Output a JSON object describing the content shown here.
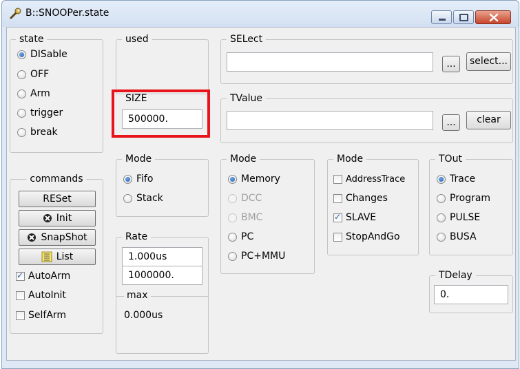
{
  "window": {
    "title": "B::SNOOPer.state",
    "icon": "wrench-icon",
    "controls": [
      "minimize",
      "maximize",
      "close"
    ]
  },
  "state": {
    "label": "state",
    "options": [
      "DISable",
      "OFF",
      "Arm",
      "trigger",
      "break"
    ],
    "selected": "DISable"
  },
  "commands": {
    "label": "commands",
    "buttons": {
      "reset": "RESet",
      "init": "Init",
      "snapshot": "SnapShot",
      "list": "List"
    },
    "checks": [
      {
        "label": "AutoArm",
        "checked": true
      },
      {
        "label": "AutoInit",
        "checked": false
      },
      {
        "label": "SelfArm",
        "checked": false
      }
    ]
  },
  "used": {
    "label": "used"
  },
  "size": {
    "label": "SIZE",
    "value": "500000."
  },
  "mode_buffer": {
    "label": "Mode",
    "options": [
      "Fifo",
      "Stack"
    ],
    "selected": "Fifo"
  },
  "rate": {
    "label": "Rate",
    "value1": "1.000us",
    "value2": "1000000.",
    "max_label": "max",
    "max_value": "0.000us"
  },
  "select": {
    "label": "SELect",
    "value": "",
    "browse_label": "...",
    "button_label": "select..."
  },
  "tvalue": {
    "label": "TValue",
    "value": "",
    "browse_label": "...",
    "button_label": "clear"
  },
  "mode_access": {
    "label": "Mode",
    "options": [
      {
        "label": "Memory",
        "enabled": true
      },
      {
        "label": "DCC",
        "enabled": false
      },
      {
        "label": "BMC",
        "enabled": false
      },
      {
        "label": "PC",
        "enabled": true
      },
      {
        "label": "PC+MMU",
        "enabled": true
      }
    ],
    "selected": "Memory"
  },
  "mode_flags": {
    "label": "Mode",
    "checks": [
      {
        "label": "AddressTrace",
        "checked": false
      },
      {
        "label": "Changes",
        "checked": false
      },
      {
        "label": "SLAVE",
        "checked": true
      },
      {
        "label": "StopAndGo",
        "checked": false
      }
    ]
  },
  "tout": {
    "label": "TOut",
    "options": [
      "Trace",
      "Program",
      "PULSE",
      "BUSA"
    ],
    "selected": "Trace"
  },
  "tdelay": {
    "label": "TDelay",
    "value": "0."
  },
  "colors": {
    "accent_highlight": "#e8141b",
    "radio_selected": "#1f5fb3",
    "check_mark": "#2a5ba8",
    "window_bg": "#f0f0f0"
  }
}
